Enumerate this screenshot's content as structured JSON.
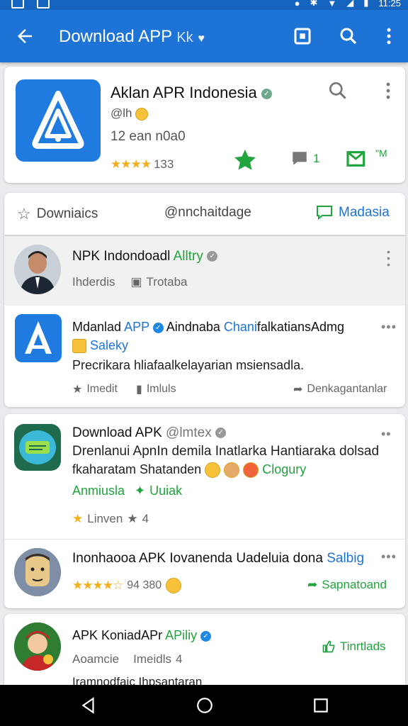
{
  "status_bar": {
    "time": "11:25"
  },
  "app_bar": {
    "title": "Download APP",
    "title_suffix": "Kk"
  },
  "header_card": {
    "app_name": "Aklan APR Indonesia",
    "handle": "@lh",
    "date": "12 ean n0a0",
    "rating_count": "133",
    "share_count": "1",
    "msg_label": "\"M"
  },
  "tabs": [
    {
      "label": "Downiaics"
    },
    {
      "label": "@nnchaitdage"
    },
    {
      "label": "Madasia"
    }
  ],
  "post1": {
    "title": "NPK Indondoadl",
    "tag": "Alltry",
    "meta1": "Ihderdis",
    "meta2": "Trotaba"
  },
  "post2": {
    "title_a": "Mdanlad",
    "title_app": "APP",
    "title_b": "Aindnaba",
    "title_c": "Chani",
    "title_d": "falkatiansAdmg",
    "sub": "Saleky",
    "body": "Precrikara hliafaalkelayarian msiensadla.",
    "act1": "Imedit",
    "act2": "Imluls",
    "act3": "Denkagantanlar"
  },
  "post3": {
    "title": "Download APK",
    "handle": "@lmtex",
    "line1": "Drenlanui ApnIn demila Inatlarka Hantiaraka dolsad",
    "line2": "fkaharatam Shatanden",
    "tag": "Clogury",
    "g1": "Anmiusla",
    "g2": "Uuiak",
    "meta": "Linven",
    "count": "4"
  },
  "post4": {
    "title": "Inonhaooa APK Iovanenda Uadeluia dona",
    "tag": "Salbig",
    "count": "94 380",
    "action": "Sapnatoand"
  },
  "post5": {
    "title": "APK KoniadAPr",
    "tag": "APiliy",
    "action": "Tinrtlads",
    "m1": "Aoamcie",
    "m2": "Imeidls",
    "m3": "4",
    "tail": "Iramnodfaic Ihpsantaran"
  }
}
